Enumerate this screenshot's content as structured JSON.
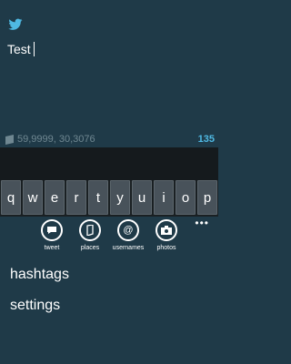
{
  "compose": {
    "text": "Test",
    "location": "59,9999, 30,3076",
    "char_count": "135",
    "icons": {
      "bird": "bird-icon",
      "location": "location-flag-icon"
    },
    "colors": {
      "background": "#1f3a48",
      "count": "#4fb9e3",
      "location": "#6f8791"
    }
  },
  "keyboard": {
    "keys": [
      "q",
      "w",
      "e",
      "r",
      "t",
      "y",
      "u",
      "i",
      "o",
      "p"
    ]
  },
  "appbar": {
    "buttons": [
      {
        "label": "tweet",
        "icon": "tweet-icon"
      },
      {
        "label": "places",
        "icon": "places-icon"
      },
      {
        "label": "usernames",
        "icon": "at-icon"
      },
      {
        "label": "photos",
        "icon": "camera-icon"
      }
    ],
    "more": "•••"
  },
  "menu": {
    "items": [
      "hashtags",
      "settings"
    ]
  }
}
